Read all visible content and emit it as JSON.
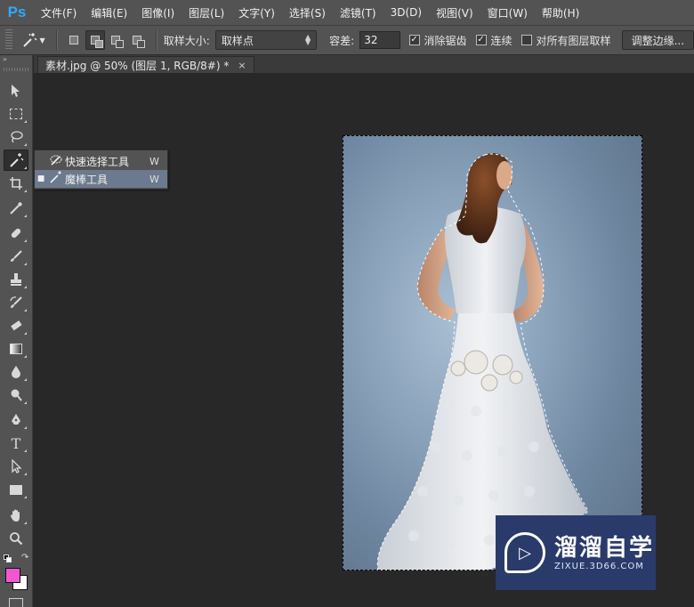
{
  "app": {
    "logo": "Ps",
    "accent": "#31a8ff"
  },
  "menu": [
    "文件(F)",
    "编辑(E)",
    "图像(I)",
    "图层(L)",
    "文字(Y)",
    "选择(S)",
    "滤镜(T)",
    "3D(D)",
    "视图(V)",
    "窗口(W)",
    "帮助(H)"
  ],
  "options": {
    "tool_icon": "magic-wand-icon",
    "sample_size_label": "取样大小:",
    "sample_size_value": "取样点",
    "tolerance_label": "容差:",
    "tolerance_value": "32",
    "anti_alias_label": "消除锯齿",
    "anti_alias_checked": true,
    "contiguous_label": "连续",
    "contiguous_checked": true,
    "sample_all_layers_label": "对所有图层取样",
    "sample_all_layers_checked": false,
    "refine_edge_label": "调整边缘..."
  },
  "toolbar": {
    "collapse_label": "»",
    "foreground_color": "#f058d0",
    "background_color": "#ffffff"
  },
  "document": {
    "tab_title": "素材.jpg @ 50% (图层 1, RGB/8#) *",
    "close_glyph": "×"
  },
  "flyout": {
    "items": [
      {
        "icon": "quick-selection-icon",
        "label": "快速选择工具",
        "shortcut": "W"
      },
      {
        "icon": "magic-wand-icon",
        "label": "魔棒工具",
        "shortcut": "W",
        "selected": true
      }
    ]
  },
  "watermark": {
    "title": "溜溜自学",
    "url": "ZIXUE.3D66.COM"
  }
}
